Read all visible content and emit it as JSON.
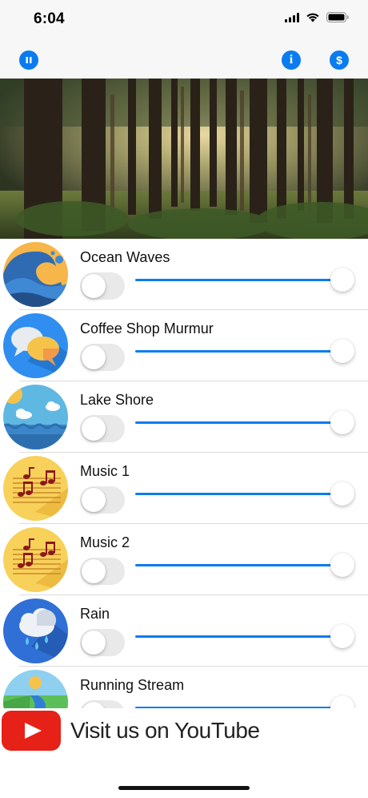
{
  "status_bar": {
    "time": "6:04"
  },
  "nav_bar": {
    "pause_icon": "pause-icon",
    "info_icon": "info-icon",
    "dollar_icon": "dollar-icon",
    "accent_color": "#0a7cf0"
  },
  "hero": {
    "image": "forest-sunlight-image"
  },
  "sounds": [
    {
      "name": "Ocean Waves",
      "icon": "ocean-waves-icon",
      "enabled": false,
      "volume": 1.0
    },
    {
      "name": "Coffee Shop Murmur",
      "icon": "chat-bubbles-icon",
      "enabled": false,
      "volume": 1.0
    },
    {
      "name": "Lake Shore",
      "icon": "lake-shore-icon",
      "enabled": false,
      "volume": 1.0
    },
    {
      "name": "Music 1",
      "icon": "music-notes-icon",
      "enabled": false,
      "volume": 1.0
    },
    {
      "name": "Music 2",
      "icon": "music-notes-icon",
      "enabled": false,
      "volume": 1.0
    },
    {
      "name": "Rain",
      "icon": "rain-cloud-icon",
      "enabled": false,
      "volume": 1.0
    },
    {
      "name": "Running Stream",
      "icon": "running-stream-icon",
      "enabled": false,
      "volume": 1.0
    }
  ],
  "banner": {
    "text": "Visit us on YouTube",
    "icon": "youtube-icon"
  }
}
